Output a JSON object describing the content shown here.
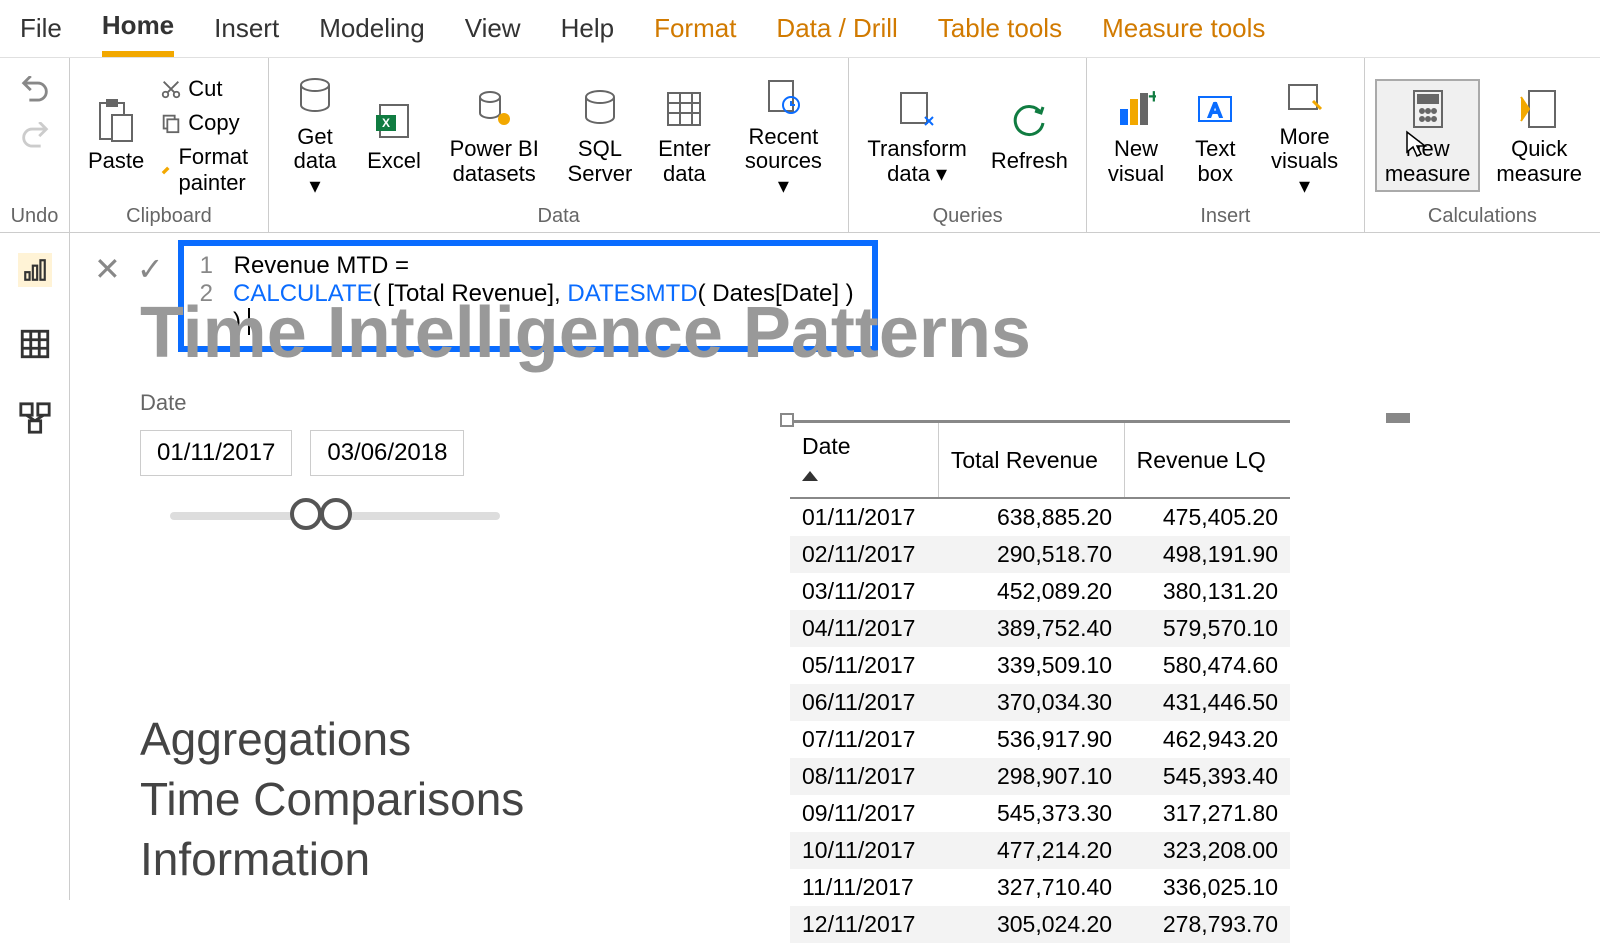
{
  "menu": [
    "File",
    "Home",
    "Insert",
    "Modeling",
    "View",
    "Help",
    "Format",
    "Data / Drill",
    "Table tools",
    "Measure tools"
  ],
  "menu_active_index": 1,
  "menu_orange_start": 6,
  "ribbon": {
    "undo_label": "Undo",
    "clipboard": {
      "paste": "Paste",
      "cut": "Cut",
      "copy": "Copy",
      "format_painter": "Format painter",
      "label": "Clipboard"
    },
    "data": {
      "get_data": "Get\ndata",
      "excel": "Excel",
      "pbi_ds": "Power BI\ndatasets",
      "sql": "SQL\nServer",
      "enter": "Enter\ndata",
      "recent": "Recent\nsources",
      "label": "Data"
    },
    "queries": {
      "transform": "Transform\ndata",
      "refresh": "Refresh",
      "label": "Queries"
    },
    "insert": {
      "new_visual": "New\nvisual",
      "text_box": "Text\nbox",
      "more": "More\nvisuals",
      "label": "Insert"
    },
    "calc": {
      "new_measure": "New\nmeasure",
      "quick": "Quick\nmeasure",
      "label": "Calculations"
    }
  },
  "formula": {
    "line1": "Revenue MTD =",
    "line2_calc": "CALCULATE",
    "line2_mid": "( [Total Revenue], ",
    "line2_fn": "DATESMTD",
    "line2_end": "( Dates[Date] ) )"
  },
  "bg_title": "Time Intelligence Patterns",
  "slicer": {
    "label": "Date",
    "start": "01/11/2017",
    "end": "03/06/2018"
  },
  "text_list": [
    "Aggregations",
    "Time Comparisons",
    "Information"
  ],
  "table": {
    "headers": [
      "Date",
      "Total Revenue",
      "Revenue LQ"
    ],
    "rows": [
      [
        "01/11/2017",
        "638,885.20",
        "475,405.20"
      ],
      [
        "02/11/2017",
        "290,518.70",
        "498,191.90"
      ],
      [
        "03/11/2017",
        "452,089.20",
        "380,131.20"
      ],
      [
        "04/11/2017",
        "389,752.40",
        "579,570.10"
      ],
      [
        "05/11/2017",
        "339,509.10",
        "580,474.60"
      ],
      [
        "06/11/2017",
        "370,034.30",
        "431,446.50"
      ],
      [
        "07/11/2017",
        "536,917.90",
        "462,943.20"
      ],
      [
        "08/11/2017",
        "298,907.10",
        "545,393.40"
      ],
      [
        "09/11/2017",
        "545,373.30",
        "317,271.80"
      ],
      [
        "10/11/2017",
        "477,214.20",
        "323,208.00"
      ],
      [
        "11/11/2017",
        "327,710.40",
        "336,025.10"
      ],
      [
        "12/11/2017",
        "305,024.20",
        "278,793.70"
      ]
    ]
  }
}
